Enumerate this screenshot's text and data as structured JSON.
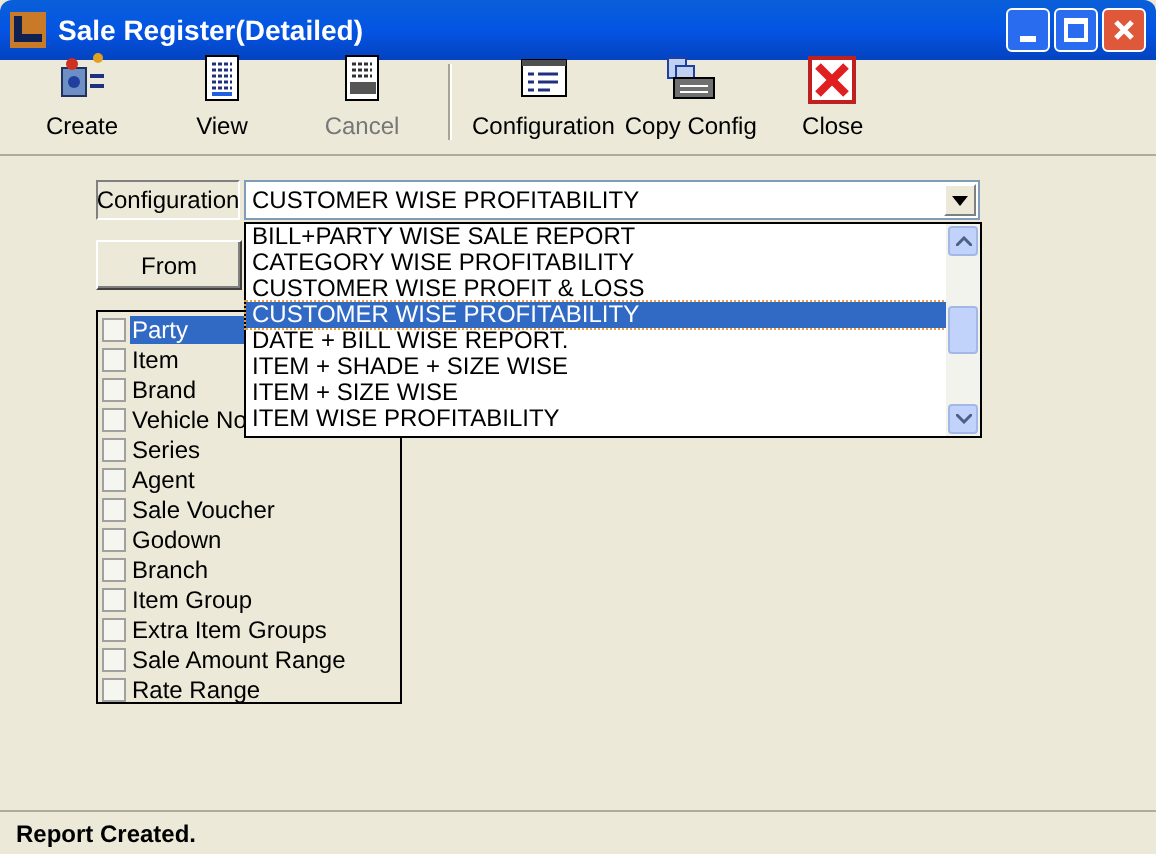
{
  "window": {
    "title": "Sale Register(Detailed)"
  },
  "toolbar": [
    {
      "label": "Create",
      "kind": "create",
      "disabled": false
    },
    {
      "label": "View",
      "kind": "view",
      "disabled": false
    },
    {
      "label": "Cancel",
      "kind": "cancel",
      "disabled": true
    },
    {
      "label": "Configuration",
      "kind": "config",
      "disabled": false
    },
    {
      "label": "Copy Config",
      "kind": "copy",
      "disabled": false
    },
    {
      "label": "Close",
      "kind": "close",
      "disabled": false
    }
  ],
  "configuration": {
    "label": "Configuration",
    "value": "CUSTOMER WISE PROFITABILITY",
    "options": [
      {
        "text": "BILL+PARTY WISE SALE REPORT",
        "selected": false
      },
      {
        "text": "CATEGORY WISE PROFITABILITY",
        "selected": false
      },
      {
        "text": "CUSTOMER WISE PROFIT & LOSS",
        "selected": false
      },
      {
        "text": "CUSTOMER WISE PROFITABILITY",
        "selected": true
      },
      {
        "text": "DATE + BILL WISE REPORT.",
        "selected": false
      },
      {
        "text": "ITEM + SHADE + SIZE WISE",
        "selected": false
      },
      {
        "text": "ITEM + SIZE WISE",
        "selected": false
      },
      {
        "text": "ITEM WISE PROFITABILITY",
        "selected": false
      }
    ]
  },
  "from_button": "From",
  "filters": [
    {
      "label": "Party",
      "checked": false,
      "selected": true
    },
    {
      "label": "Item",
      "checked": false,
      "selected": false
    },
    {
      "label": "Brand",
      "checked": false,
      "selected": false
    },
    {
      "label": "Vehicle No",
      "checked": false,
      "selected": false
    },
    {
      "label": "Series",
      "checked": false,
      "selected": false
    },
    {
      "label": "Agent",
      "checked": false,
      "selected": false
    },
    {
      "label": "Sale Voucher",
      "checked": false,
      "selected": false
    },
    {
      "label": "Godown",
      "checked": false,
      "selected": false
    },
    {
      "label": "Branch",
      "checked": false,
      "selected": false
    },
    {
      "label": "Item Group",
      "checked": false,
      "selected": false
    },
    {
      "label": "Extra Item Groups",
      "checked": false,
      "selected": false
    },
    {
      "label": "Sale Amount Range",
      "checked": false,
      "selected": false
    },
    {
      "label": "Rate Range",
      "checked": false,
      "selected": false
    }
  ],
  "status_bar": "Report Created."
}
